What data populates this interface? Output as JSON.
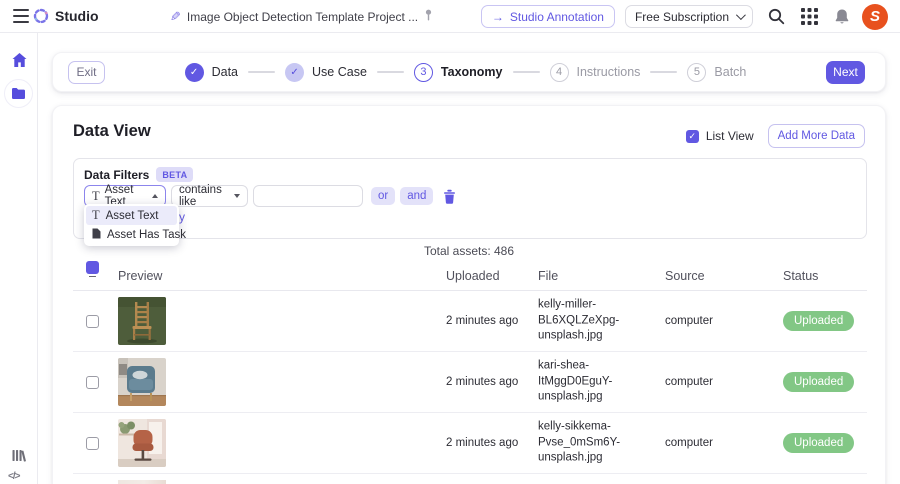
{
  "topbar": {
    "app_name": "Studio",
    "project_title": "Image Object Detection Template Project ...",
    "annotation_button": "Studio Annotation",
    "subscription_button": "Free Subscription",
    "avatar_letter": "S"
  },
  "stepper": {
    "exit_label": "Exit",
    "next_label": "Next",
    "steps": [
      {
        "label": "Data",
        "state": "completed"
      },
      {
        "label": "Use Case",
        "state": "completed"
      },
      {
        "label": "Taxonomy",
        "number": "3",
        "state": "active"
      },
      {
        "label": "Instructions",
        "number": "4",
        "state": "pending"
      },
      {
        "label": "Batch",
        "number": "5",
        "state": "pending"
      }
    ]
  },
  "data_view": {
    "title": "Data View",
    "list_view_label": "List View",
    "add_more_data_label": "Add More Data",
    "filters": {
      "title": "Data Filters",
      "beta_badge": "BETA",
      "field_selected": "Asset Text",
      "operator_selected": "contains like",
      "value": "",
      "or_label": "or",
      "and_label": "and",
      "partially_hidden_link_text": "ry",
      "dropdown_options": [
        {
          "label": "Asset Text",
          "icon": "text-type-icon"
        },
        {
          "label": "Asset Has Task",
          "icon": "document-icon"
        }
      ]
    },
    "total_assets": "Total assets: 486"
  },
  "table": {
    "columns": [
      "Preview",
      "Uploaded",
      "File",
      "Source",
      "Status"
    ],
    "rows": [
      {
        "uploaded": "2 minutes ago",
        "file": "kelly-miller-BL6XQLZeXpg-unsplash.jpg",
        "source": "computer",
        "status": "Uploaded"
      },
      {
        "uploaded": "2 minutes ago",
        "file": "kari-shea-ItMggD0EguY-unsplash.jpg",
        "source": "computer",
        "status": "Uploaded"
      },
      {
        "uploaded": "2 minutes ago",
        "file": "kelly-sikkema-Pvse_0mSm6Y-unsplash.jpg",
        "source": "computer",
        "status": "Uploaded"
      }
    ]
  },
  "icons": {
    "check": "✓",
    "minus": "–",
    "pencil": "✎",
    "arrow_right": "→",
    "text_type": "T",
    "code": "</>"
  },
  "icon_names": [
    "menu-icon",
    "studio-logo",
    "pencil-icon",
    "pin-icon",
    "arrow-right-icon",
    "chevron-down-icon",
    "search-icon",
    "apps-grid-icon",
    "bell-icon",
    "avatar",
    "home-icon",
    "folder-icon",
    "library-icon",
    "code-icon",
    "check-icon",
    "indeterminate-icon",
    "text-type-icon",
    "document-icon",
    "trash-icon",
    "caret-up-icon",
    "caret-down-icon"
  ],
  "colors": {
    "accent": "#6158e2",
    "accent_light": "#c9c5f3",
    "chip_bg": "#e3e2f9",
    "beta_bg": "#dedcf8",
    "green": "#82c785",
    "border": "#e4e4ea",
    "text_dark": "#26262e",
    "text_gray": "#9a9aa4"
  }
}
